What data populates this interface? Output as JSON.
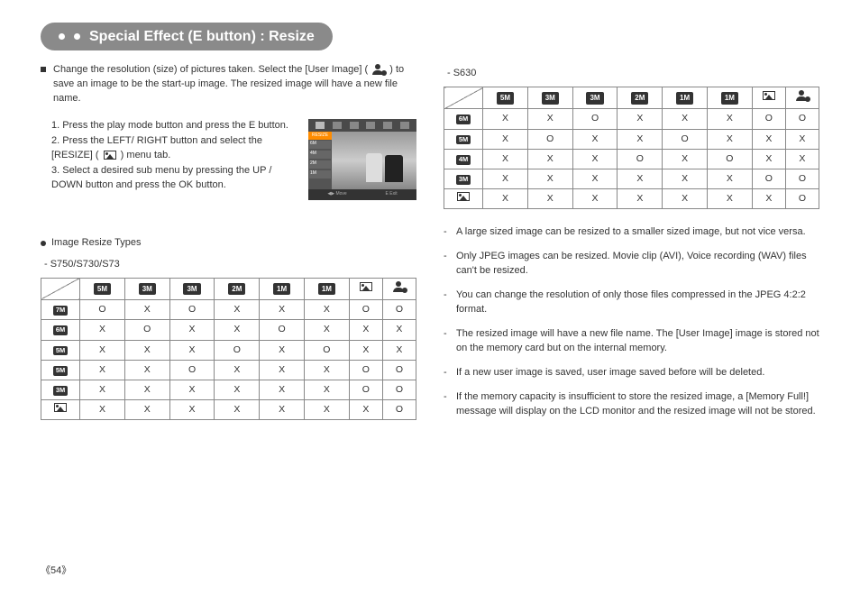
{
  "title": "Special Effect (E button) : Resize",
  "intro": "Change the resolution (size) of pictures taken. Select the [User Image] (        ) to save an image to be the start-up image. The resized image will have a new file name.",
  "steps": [
    "1. Press the play mode button and press the E button.",
    "2. Press the LEFT/ RIGHT button and select the [RESIZE] (        ) menu tab.",
    "3. Select a desired sub menu by pressing the UP / DOWN button and press the OK button."
  ],
  "lcd": {
    "label": "RESIZE",
    "opts": [
      "6M",
      "4M",
      "2M",
      "1M"
    ],
    "move": "Move",
    "exit": "Exit"
  },
  "subhead": "Image Resize Types",
  "model1": "- S750/S730/S73",
  "model2": "- S630",
  "cols": [
    "5M",
    "3M",
    "3M",
    "2M",
    "1M",
    "1M"
  ],
  "rowsA": [
    "7M",
    "6M",
    "5M",
    "5M",
    "3M"
  ],
  "table1": [
    [
      "O",
      "X",
      "O",
      "X",
      "X",
      "X",
      "O",
      "O"
    ],
    [
      "X",
      "O",
      "X",
      "X",
      "O",
      "X",
      "X",
      "X"
    ],
    [
      "X",
      "X",
      "X",
      "O",
      "X",
      "O",
      "X",
      "X"
    ],
    [
      "X",
      "X",
      "O",
      "X",
      "X",
      "X",
      "O",
      "O"
    ],
    [
      "X",
      "X",
      "X",
      "X",
      "X",
      "X",
      "O",
      "O"
    ],
    [
      "X",
      "X",
      "X",
      "X",
      "X",
      "X",
      "X",
      "O"
    ]
  ],
  "rowsB": [
    "6M",
    "5M",
    "4M",
    "3M"
  ],
  "table2": [
    [
      "X",
      "X",
      "O",
      "X",
      "X",
      "X",
      "O",
      "O"
    ],
    [
      "X",
      "O",
      "X",
      "X",
      "O",
      "X",
      "X",
      "X"
    ],
    [
      "X",
      "X",
      "X",
      "O",
      "X",
      "O",
      "X",
      "X"
    ],
    [
      "X",
      "X",
      "X",
      "X",
      "X",
      "X",
      "O",
      "O"
    ],
    [
      "X",
      "X",
      "X",
      "X",
      "X",
      "X",
      "X",
      "O"
    ]
  ],
  "notes": [
    "A large sized image can be resized to a smaller sized image, but not vice versa.",
    "Only JPEG images can be resized. Movie clip (AVI), Voice recording (WAV) files can't be resized.",
    "You can change the resolution of only those files compressed in the JPEG 4:2:2 format.",
    "The resized image will have a new file name. The [User Image] image is stored not on the memory card but on the internal memory.",
    "If a new user image is saved, user image saved before will be deleted.",
    "If the memory capacity is insufficient to store the resized image, a [Memory Full!] message will display on the LCD monitor and the resized image will not be stored."
  ],
  "page": "《54》"
}
